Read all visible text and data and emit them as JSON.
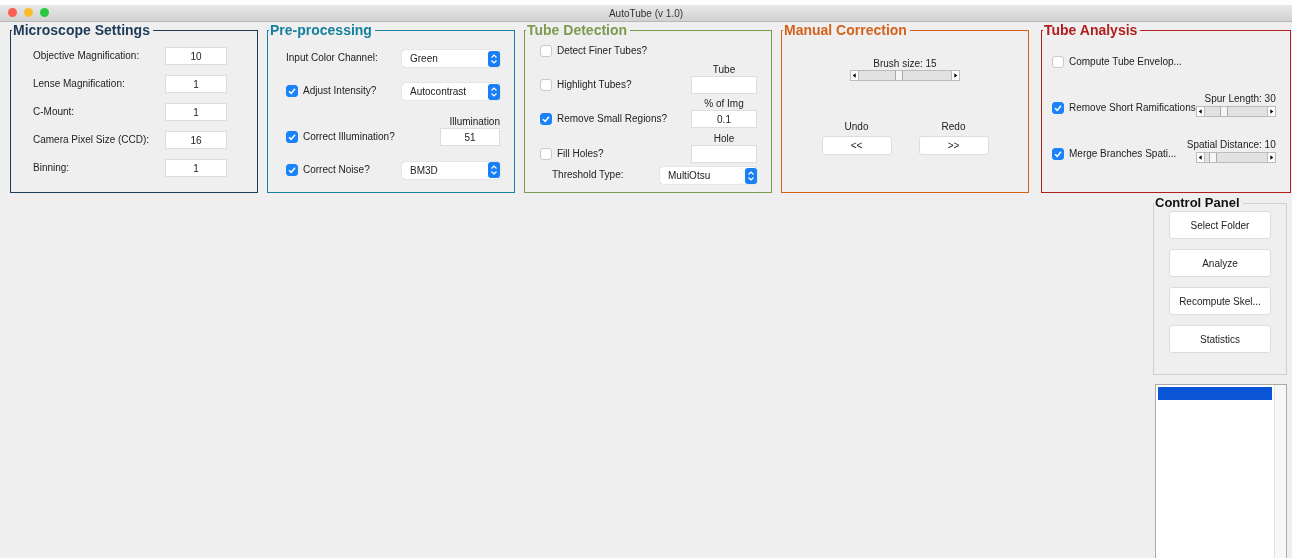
{
  "window": {
    "title": "AutoTube (v 1.0)"
  },
  "panels": [
    {
      "title": "Microscope Settings",
      "color": "#1d3a57",
      "rows": [
        {
          "kind": "field",
          "label": "Objective Magnification:",
          "value": "10"
        },
        {
          "kind": "field",
          "label": "Lense Magnification:",
          "value": "1"
        },
        {
          "kind": "field",
          "label": "C-Mount:",
          "value": "1"
        },
        {
          "kind": "field",
          "label": "Camera Pixel Size (CCD):",
          "value": "16"
        },
        {
          "kind": "field",
          "label": "Binning:",
          "value": "1"
        }
      ]
    },
    {
      "title": "Pre-processing",
      "color": "#17809f",
      "rows": [
        {
          "kind": "select",
          "label": "Input Color Channel:",
          "value": "Green"
        },
        {
          "kind": "check",
          "label": "Adjust Intensity?",
          "checked": true,
          "control": {
            "kind": "select",
            "value": "Autocontrast"
          }
        },
        {
          "kind": "check",
          "label": "Correct Illumination?",
          "checked": true,
          "control": {
            "kind": "field",
            "caption": "Illumination",
            "value": "51"
          }
        },
        {
          "kind": "check",
          "label": "Correct Noise?",
          "checked": true,
          "control": {
            "kind": "select",
            "value": "BM3D"
          }
        }
      ]
    },
    {
      "title": "Tube Detection",
      "color": "#7d9a4e",
      "rows": [
        {
          "kind": "check",
          "label": "Detect Finer Tubes?",
          "checked": false
        },
        {
          "kind": "check",
          "label": "Highlight Tubes?",
          "checked": false,
          "control": {
            "kind": "field",
            "caption": "Tube"
          }
        },
        {
          "kind": "check",
          "label": "Remove Small Regions?",
          "checked": true,
          "control": {
            "kind": "field",
            "caption": "% of Img",
            "value": "0.1"
          }
        },
        {
          "kind": "check",
          "label": "Fill Holes?",
          "checked": false,
          "control": {
            "kind": "field",
            "caption": "Hole"
          }
        },
        {
          "kind": "select",
          "label": "Threshold Type:",
          "value": "MultiOtsu"
        }
      ]
    },
    {
      "title": "Manual Correction",
      "color": "#d4621c",
      "rows": [
        {
          "kind": "slider",
          "caption": "Brush size: 15",
          "level": 0.43
        },
        {
          "kind": "buttons",
          "buttons": [
            {
              "caption": "Undo",
              "label": "<<"
            },
            {
              "caption": "Redo",
              "label": ">>"
            }
          ]
        }
      ]
    },
    {
      "title": "Tube Analysis",
      "color": "#b01e1e",
      "rows": [
        {
          "kind": "check",
          "label": "Compute Tube Envelop...",
          "checked": false
        },
        {
          "kind": "check",
          "label": "Remove Short Ramifications",
          "checked": true,
          "control": {
            "kind": "slider",
            "caption": "Spur Length: 30",
            "level": 0.31
          }
        },
        {
          "kind": "check",
          "label": "Merge Branches Spati...",
          "checked": true,
          "control": {
            "kind": "slider",
            "caption": "Spatial Distance: 10",
            "level": 0.14
          }
        }
      ]
    }
  ],
  "control_panel": {
    "title": "Control Panel",
    "buttons": [
      "Select Folder",
      "Analyze",
      "Recompute Skel...",
      "Statistics"
    ]
  },
  "listbox": {
    "items": [
      {
        "selected": true
      }
    ]
  }
}
